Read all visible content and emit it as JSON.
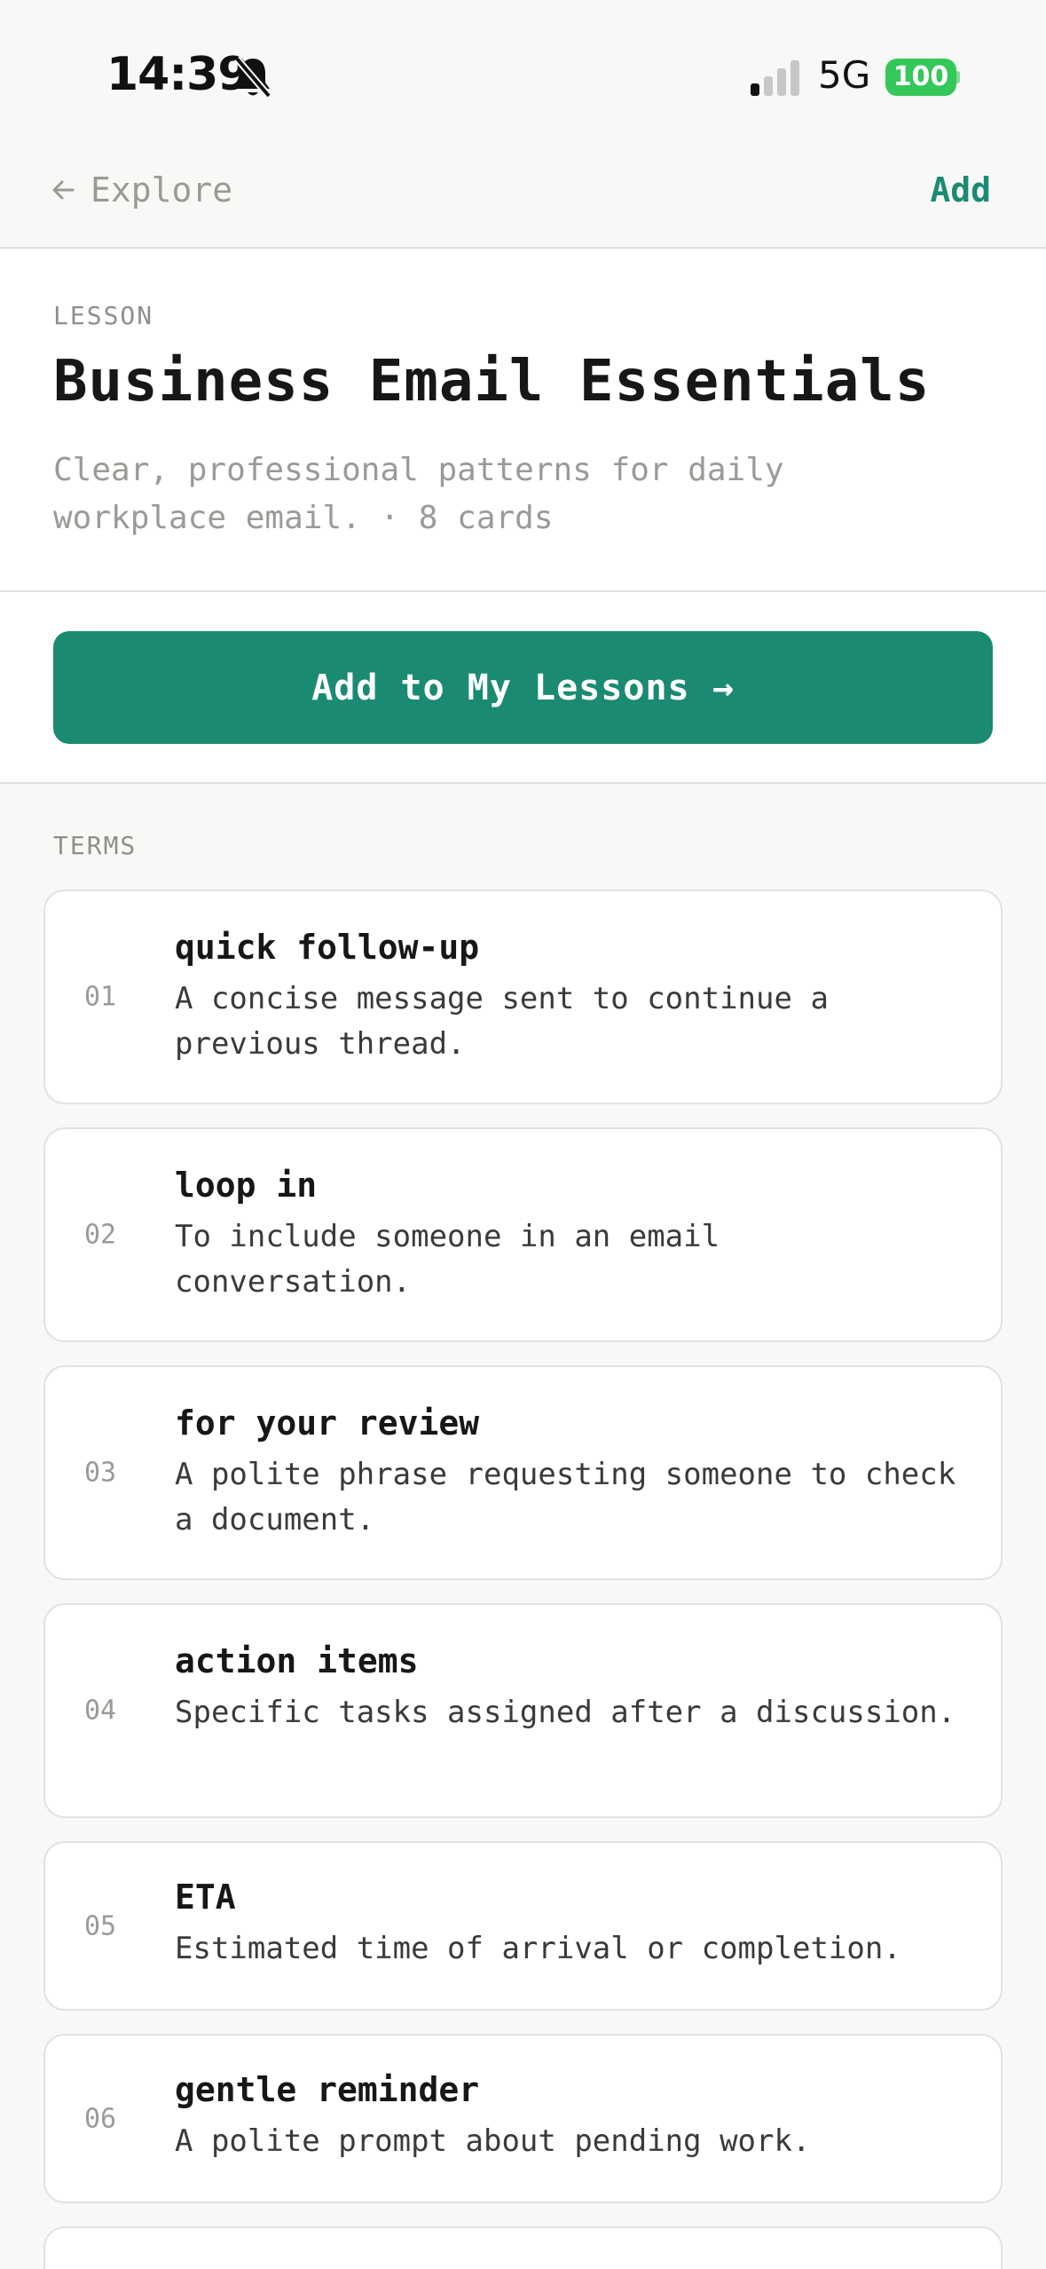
{
  "status_bar": {
    "time": "14:39",
    "network": "5G",
    "battery": "100",
    "icons": [
      "bell-slash-icon",
      "signal-icon",
      "battery-icon"
    ]
  },
  "nav": {
    "back_label": "Explore",
    "add_label": "Add"
  },
  "lesson": {
    "eyebrow": "LESSON",
    "title": "Business Email Essentials",
    "description": "Clear, professional patterns for daily workplace email. · 8 cards"
  },
  "cta": {
    "label": "Add to My Lessons →"
  },
  "terms": {
    "label": "TERMS",
    "items": [
      {
        "num": "01",
        "term": "quick follow-up",
        "definition": "A concise message sent to continue a previous thread."
      },
      {
        "num": "02",
        "term": "loop in",
        "definition": "To include someone in an email conversation."
      },
      {
        "num": "03",
        "term": "for your review",
        "definition": "A polite phrase requesting someone to check a document."
      },
      {
        "num": "04",
        "term": "action items",
        "definition": "Specific tasks assigned after a discussion."
      },
      {
        "num": "05",
        "term": "ETA",
        "definition": "Estimated time of arrival or completion."
      },
      {
        "num": "06",
        "term": "gentle reminder",
        "definition": "A polite prompt about pending work."
      }
    ]
  },
  "colors": {
    "accent": "#1b8a73",
    "battery": "#34c759",
    "background": "#f8f8f6",
    "card": "#ffffff",
    "muted_text": "#9a9a96"
  }
}
